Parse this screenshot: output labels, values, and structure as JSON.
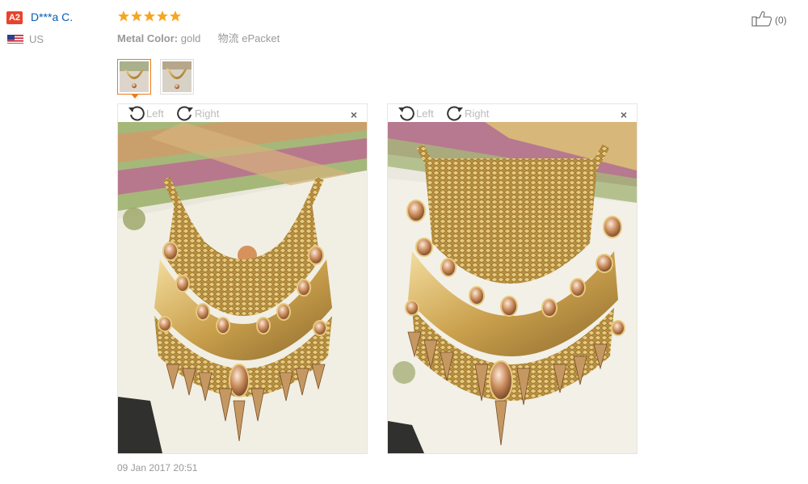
{
  "review": {
    "user": {
      "level_badge": "A2",
      "name": "D***a C.",
      "country": "US",
      "flag_icon": "us-flag-icon"
    },
    "rating": {
      "stars": 5,
      "max": 5,
      "color": "#f5a623"
    },
    "meta": [
      {
        "key": "Metal Color:",
        "value": "gold"
      },
      {
        "key": "物流",
        "value": "ePacket"
      }
    ],
    "helpful": {
      "icon": "thumbs-up-icon",
      "count": "(0)"
    },
    "thumbnails": [
      {
        "icon": "necklace-photo-1",
        "active": true
      },
      {
        "icon": "necklace-photo-2",
        "active": false
      }
    ],
    "viewers": [
      {
        "rotate_left": "Left",
        "rotate_right": "Right",
        "close": "×",
        "photo": "gold-statement-necklace-photo-1"
      },
      {
        "rotate_left": "Left",
        "rotate_right": "Right",
        "close": "×",
        "photo": "gold-statement-necklace-photo-2"
      }
    ],
    "date": "09 Jan 2017 20:51"
  },
  "colors": {
    "accent": "#f07a18",
    "link": "#0a5bb5",
    "badge": "#e8432d"
  }
}
